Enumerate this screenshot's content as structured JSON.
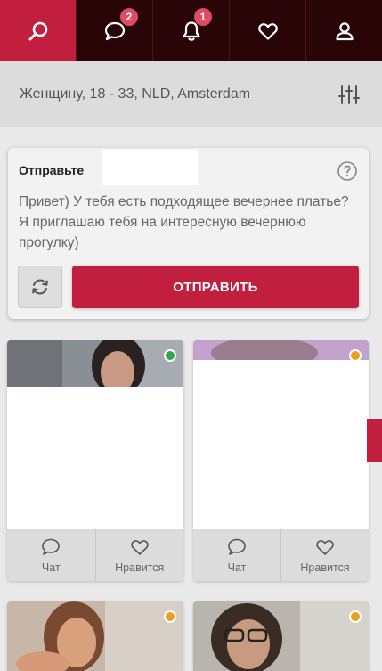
{
  "nav": {
    "tabs": [
      {
        "name": "search",
        "icon": "search-icon",
        "active": true
      },
      {
        "name": "messages",
        "icon": "chat-icon",
        "badge": "2"
      },
      {
        "name": "notifications",
        "icon": "bell-icon",
        "badge": "1"
      },
      {
        "name": "favorites",
        "icon": "heart-icon"
      },
      {
        "name": "profile",
        "icon": "user-icon"
      }
    ]
  },
  "filter": {
    "text": "Женщину, 18 - 33, NLD, Amsterdam",
    "icon": "sliders-icon"
  },
  "send_card": {
    "title": "Отправьте",
    "message": "Привет) У тебя есть подходящее вечернее платье? Я приглашаю тебя на интересную вечернюю прогулку)",
    "send_label": "ОТПРАВИТЬ",
    "refresh_icon": "refresh-icon",
    "help_icon": "help-icon"
  },
  "profiles": [
    {
      "status": "online",
      "status_color": "#2fa84f",
      "chat_label": "Чат",
      "like_label": "Нравится"
    },
    {
      "status": "away",
      "status_color": "#e8a020",
      "chat_label": "Чат",
      "like_label": "Нравится"
    },
    {
      "status": "away",
      "status_color": "#e8a020"
    },
    {
      "status": "away",
      "status_color": "#e8a020"
    }
  ],
  "colors": {
    "accent": "#c21f3e",
    "nav_bg": "#2a0508",
    "badge": "#e04a63"
  }
}
